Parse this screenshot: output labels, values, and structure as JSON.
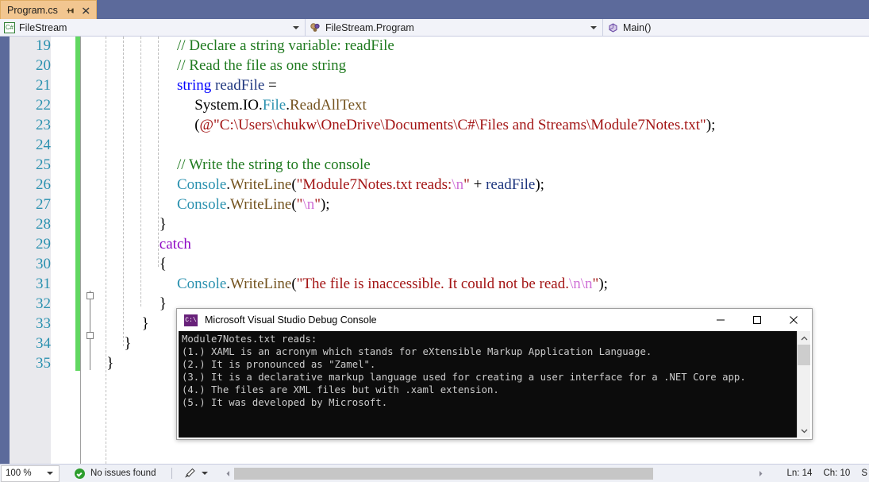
{
  "tab": {
    "title": "Program.cs",
    "pin_icon": "pin-icon",
    "close_icon": "close-icon"
  },
  "navbar": {
    "project": "FileStream",
    "project_icon": "csharp-file-icon",
    "type": "FileStream.Program",
    "type_icon": "class-icon",
    "member": "Main()",
    "member_icon": "method-icon",
    "dropdown_icon": "chevron-down-icon"
  },
  "editor": {
    "lines": [
      {
        "no": "19",
        "indent": 5,
        "tokens": [
          {
            "t": "// Declare a string variable: readFile",
            "c": "c-comment"
          }
        ]
      },
      {
        "no": "20",
        "indent": 5,
        "tokens": [
          {
            "t": "// Read the file as one string",
            "c": "c-comment"
          }
        ]
      },
      {
        "no": "21",
        "indent": 5,
        "tokens": [
          {
            "t": "string",
            "c": "c-keyword"
          },
          {
            "t": " ",
            "c": "c-plain"
          },
          {
            "t": "readFile",
            "c": "c-local"
          },
          {
            "t": " =",
            "c": "c-plain"
          }
        ]
      },
      {
        "no": "22",
        "indent": 6,
        "tokens": [
          {
            "t": "System.IO.",
            "c": "c-plain"
          },
          {
            "t": "File",
            "c": "c-class"
          },
          {
            "t": ".",
            "c": "c-plain"
          },
          {
            "t": "ReadAllText",
            "c": "c-method"
          }
        ]
      },
      {
        "no": "23",
        "indent": 6,
        "tokens": [
          {
            "t": "(",
            "c": "c-plain"
          },
          {
            "t": "@\"C:\\Users\\chukw\\OneDrive\\Documents\\C#\\Files and Streams\\Module7Notes.txt\"",
            "c": "c-string"
          },
          {
            "t": ");",
            "c": "c-plain"
          }
        ]
      },
      {
        "no": "24",
        "indent": 0,
        "tokens": []
      },
      {
        "no": "25",
        "indent": 5,
        "tokens": [
          {
            "t": "// Write the string to the console",
            "c": "c-comment"
          }
        ]
      },
      {
        "no": "26",
        "indent": 5,
        "tokens": [
          {
            "t": "Console",
            "c": "c-class"
          },
          {
            "t": ".",
            "c": "c-plain"
          },
          {
            "t": "WriteLine",
            "c": "c-method"
          },
          {
            "t": "(",
            "c": "c-plain"
          },
          {
            "t": "\"Module7Notes.txt reads:",
            "c": "c-string"
          },
          {
            "t": "\\n",
            "c": "c-escape"
          },
          {
            "t": "\"",
            "c": "c-string"
          },
          {
            "t": " + ",
            "c": "c-plain"
          },
          {
            "t": "readFile",
            "c": "c-local"
          },
          {
            "t": ");",
            "c": "c-plain"
          }
        ]
      },
      {
        "no": "27",
        "indent": 5,
        "tokens": [
          {
            "t": "Console",
            "c": "c-class"
          },
          {
            "t": ".",
            "c": "c-plain"
          },
          {
            "t": "WriteLine",
            "c": "c-method"
          },
          {
            "t": "(",
            "c": "c-plain"
          },
          {
            "t": "\"",
            "c": "c-string"
          },
          {
            "t": "\\n",
            "c": "c-escape"
          },
          {
            "t": "\"",
            "c": "c-string"
          },
          {
            "t": ");",
            "c": "c-plain"
          }
        ]
      },
      {
        "no": "28",
        "indent": 4,
        "tokens": [
          {
            "t": "}",
            "c": "c-plain"
          }
        ]
      },
      {
        "no": "29",
        "indent": 4,
        "tokens": [
          {
            "t": "catch",
            "c": "c-ctrl"
          }
        ]
      },
      {
        "no": "30",
        "indent": 4,
        "tokens": [
          {
            "t": "{",
            "c": "c-plain"
          }
        ]
      },
      {
        "no": "31",
        "indent": 5,
        "tokens": [
          {
            "t": "Console",
            "c": "c-class"
          },
          {
            "t": ".",
            "c": "c-plain"
          },
          {
            "t": "WriteLine",
            "c": "c-method"
          },
          {
            "t": "(",
            "c": "c-plain"
          },
          {
            "t": "\"The file is inaccessible. It could not be read.",
            "c": "c-string"
          },
          {
            "t": "\\n\\n",
            "c": "c-escape"
          },
          {
            "t": "\"",
            "c": "c-string"
          },
          {
            "t": ");",
            "c": "c-plain"
          }
        ]
      },
      {
        "no": "32",
        "indent": 4,
        "tokens": [
          {
            "t": "}",
            "c": "c-plain"
          }
        ]
      },
      {
        "no": "33",
        "indent": 3,
        "tokens": [
          {
            "t": "}",
            "c": "c-plain"
          }
        ]
      },
      {
        "no": "34",
        "indent": 2,
        "tokens": [
          {
            "t": "}",
            "c": "c-plain"
          }
        ]
      },
      {
        "no": "35",
        "indent": 1,
        "tokens": [
          {
            "t": "}",
            "c": "c-plain"
          }
        ]
      }
    ]
  },
  "console_window": {
    "title": "Microsoft Visual Studio Debug Console",
    "icon": "console-app-icon",
    "minimize_label": "–",
    "maximize_label": "□",
    "close_label": "✕",
    "output_lines": [
      "Module7Notes.txt reads:",
      "(1.) XAML is an acronym which stands for eXtensible Markup Application Language.",
      "(2.) It is pronounced as \"Zamel\".",
      "(3.) It is a declarative markup language used for creating a user interface for a .NET Core app.",
      "(4.) The files are XML files but with .xaml extension.",
      "(5.) It was developed by Microsoft."
    ]
  },
  "statusbar": {
    "zoom": "100 %",
    "issues_icon": "success-check-icon",
    "issues": "No issues found",
    "brush_icon": "brush-icon",
    "line_label": "Ln: 14",
    "char_label": "Ch: 10",
    "insert_label": "S"
  },
  "colors": {
    "chrome": "#5c6a9b",
    "tab_active": "#f2c690",
    "change_bar": "#61d761",
    "console_bg": "#0c0c0c",
    "accent_type": "#2b91af"
  }
}
